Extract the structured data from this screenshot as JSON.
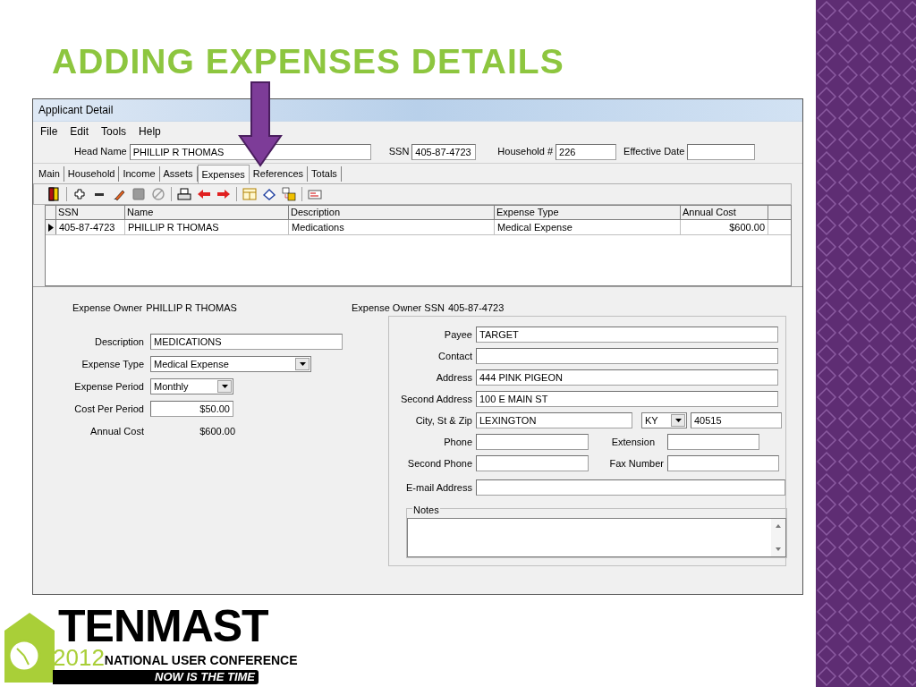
{
  "slide": {
    "title": "ADDING EXPENSES DETAILS"
  },
  "window": {
    "title": "Applicant Detail"
  },
  "menu": [
    "File",
    "Edit",
    "Tools",
    "Help"
  ],
  "header_fields": [
    {
      "label": "Head Name",
      "value": "PHILLIP R THOMAS"
    },
    {
      "label": "SSN",
      "value": "405-87-4723"
    },
    {
      "label": "Household #",
      "value": "226"
    },
    {
      "label": "Effective Date"
    }
  ],
  "tabs": [
    {
      "label": "Main",
      "selected": false
    },
    {
      "label": "Household",
      "selected": false
    },
    {
      "label": "Income",
      "selected": false
    },
    {
      "label": "Assets",
      "selected": false
    },
    {
      "label": "Expenses",
      "selected": true
    },
    {
      "label": "References",
      "selected": false
    },
    {
      "label": "Totals",
      "selected": false
    }
  ],
  "table": {
    "columns": [
      "SSN",
      "Name",
      "Description",
      "Expense Type",
      "Annual Cost"
    ],
    "rows": [
      {
        "selected": true,
        "cells": [
          "405-87-4723",
          "PHILLIP R THOMAS",
          "Medications",
          "Medical Expense",
          "$600.00"
        ]
      }
    ]
  },
  "owner": {
    "label": "Expense Owner",
    "value": "PHILLIP R THOMAS"
  },
  "owner_ssn": {
    "label": "Expense Owner SSN",
    "value": "405-87-4723"
  },
  "expense_form": [
    {
      "kind": "text",
      "label": "Description",
      "value": "MEDICATIONS"
    },
    {
      "kind": "select",
      "label": "Expense Type",
      "value": "Medical Expense"
    },
    {
      "kind": "select",
      "label": "Expense Period",
      "value": "Monthly"
    },
    {
      "kind": "amount",
      "label": "Cost Per Period",
      "value": "$50.00"
    },
    {
      "kind": "readonly",
      "label": "Annual Cost",
      "value": "$600.00"
    }
  ],
  "payee_form": [
    {
      "kind": "full",
      "fields": [
        {
          "label": "Payee",
          "value": "TARGET"
        }
      ]
    },
    {
      "kind": "full",
      "fields": [
        {
          "label": "Contact"
        }
      ]
    },
    {
      "kind": "full",
      "fields": [
        {
          "label": "Address",
          "value": "444 PINK PIGEON"
        }
      ]
    },
    {
      "kind": "full",
      "fields": [
        {
          "label": "Second Address",
          "value": "100 E MAIN ST"
        }
      ]
    },
    {
      "kind": "city",
      "label": "City, St & Zip",
      "fields": [
        {
          "value": "LEXINGTON"
        },
        {
          "value": "KY"
        },
        {
          "value": "40515"
        }
      ]
    },
    {
      "kind": "pair",
      "fields": [
        {
          "label": "Phone"
        },
        {
          "label": "Extension"
        }
      ]
    },
    {
      "kind": "pair",
      "fields": [
        {
          "label": "Second Phone"
        },
        {
          "label": "Fax Number"
        }
      ]
    },
    {
      "kind": "email",
      "fields": [
        {
          "label": "E-mail Address"
        }
      ]
    }
  ],
  "notes": {
    "label": "Notes"
  },
  "logo": {
    "brand": "TENMAST",
    "year": "2012",
    "subtitle": "NATIONAL USER CONFERENCE",
    "tagline": "NOW IS THE TIME"
  }
}
